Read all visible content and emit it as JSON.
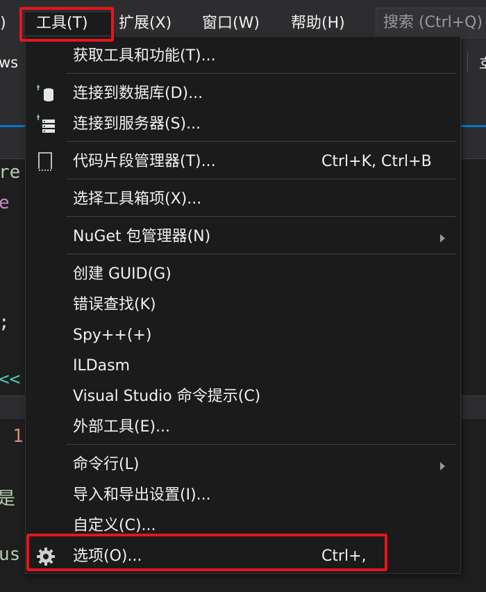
{
  "menubar": {
    "partial_left": "l)",
    "items": [
      {
        "label": "工具(T)",
        "active": true
      },
      {
        "label": "扩展(X)"
      },
      {
        "label": "窗口(W)"
      },
      {
        "label": "帮助(H)"
      }
    ],
    "search_placeholder": "搜索 (Ctrl+Q)"
  },
  "background": {
    "toolbar_partial": "ws",
    "toolbar_partial_right": "호",
    "code_lines": [
      "re",
      "e",
      ";",
      "<<",
      "1",
      "是",
      "us"
    ]
  },
  "menu": {
    "items": [
      {
        "label": "获取工具和功能(T)...",
        "icon": "none",
        "shortcut": "",
        "submenu": false
      },
      {
        "label": "连接到数据库(D)...",
        "icon": "database-connect-icon",
        "shortcut": "",
        "submenu": false
      },
      {
        "label": "连接到服务器(S)...",
        "icon": "server-connect-icon",
        "shortcut": "",
        "submenu": false
      },
      {
        "label": "代码片段管理器(T)...",
        "icon": "snippet-icon",
        "shortcut": "Ctrl+K, Ctrl+B",
        "submenu": false
      },
      {
        "label": "选择工具箱项(X)...",
        "icon": "none",
        "shortcut": "",
        "submenu": false
      },
      {
        "label": "NuGet 包管理器(N)",
        "icon": "none",
        "shortcut": "",
        "submenu": true
      },
      {
        "label": "创建 GUID(G)",
        "icon": "none",
        "shortcut": "",
        "submenu": false
      },
      {
        "label": "错误查找(K)",
        "icon": "none",
        "shortcut": "",
        "submenu": false
      },
      {
        "label": "Spy++(+)",
        "icon": "none",
        "shortcut": "",
        "submenu": false
      },
      {
        "label": "ILDasm",
        "icon": "none",
        "shortcut": "",
        "submenu": false
      },
      {
        "label": "Visual Studio 命令提示(C)",
        "icon": "none",
        "shortcut": "",
        "submenu": false
      },
      {
        "label": "外部工具(E)...",
        "icon": "none",
        "shortcut": "",
        "submenu": false
      },
      {
        "label": "命令行(L)",
        "icon": "none",
        "shortcut": "",
        "submenu": true
      },
      {
        "label": "导入和导出设置(I)...",
        "icon": "none",
        "shortcut": "",
        "submenu": false
      },
      {
        "label": "自定义(C)...",
        "icon": "none",
        "shortcut": "",
        "submenu": false
      },
      {
        "label": "选项(O)...",
        "icon": "gear-icon",
        "shortcut": "Ctrl+,",
        "submenu": false
      }
    ]
  },
  "colors": {
    "menu_bg": "#1b1b1c",
    "menubar_bg": "#2d2d30",
    "highlight_red": "#e8141c",
    "accent_blue": "#007acc",
    "code_green": "#b5cea8",
    "code_purple": "#c586c0",
    "code_teal": "#4ec9b0",
    "code_orange": "#ce9178"
  }
}
